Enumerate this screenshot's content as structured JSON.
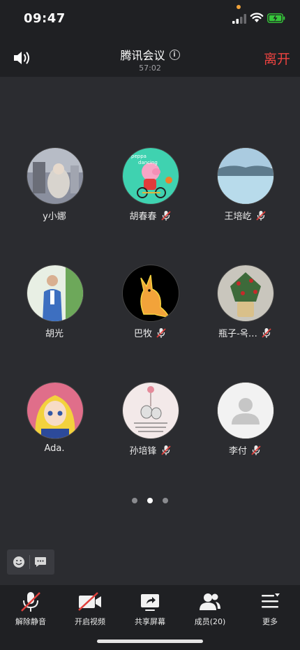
{
  "status_bar": {
    "time": "09:47"
  },
  "header": {
    "title": "腾讯会议",
    "duration": "57:02",
    "leave_label": "离开"
  },
  "participants": [
    {
      "name": "y小娜",
      "muted": false
    },
    {
      "name": "胡春春",
      "muted": true
    },
    {
      "name": "王培屹",
      "muted": true
    },
    {
      "name": "胡光",
      "muted": false
    },
    {
      "name": "巴牧",
      "muted": true
    },
    {
      "name": "瓶子-옥…",
      "muted": true
    },
    {
      "name": "Ada.",
      "muted": false
    },
    {
      "name": "孙培锋",
      "muted": true
    },
    {
      "name": "李付",
      "muted": true
    }
  ],
  "pager": {
    "pages": 3,
    "active": 1
  },
  "toolbar": {
    "unmute_label": "解除静音",
    "video_label": "开启视频",
    "share_label": "共享屏幕",
    "members_label": "成员(20)",
    "more_label": "更多"
  },
  "colors": {
    "leave": "#ee4340",
    "mute_badge": "#e0403c",
    "accent_battery": "#36c63a"
  }
}
